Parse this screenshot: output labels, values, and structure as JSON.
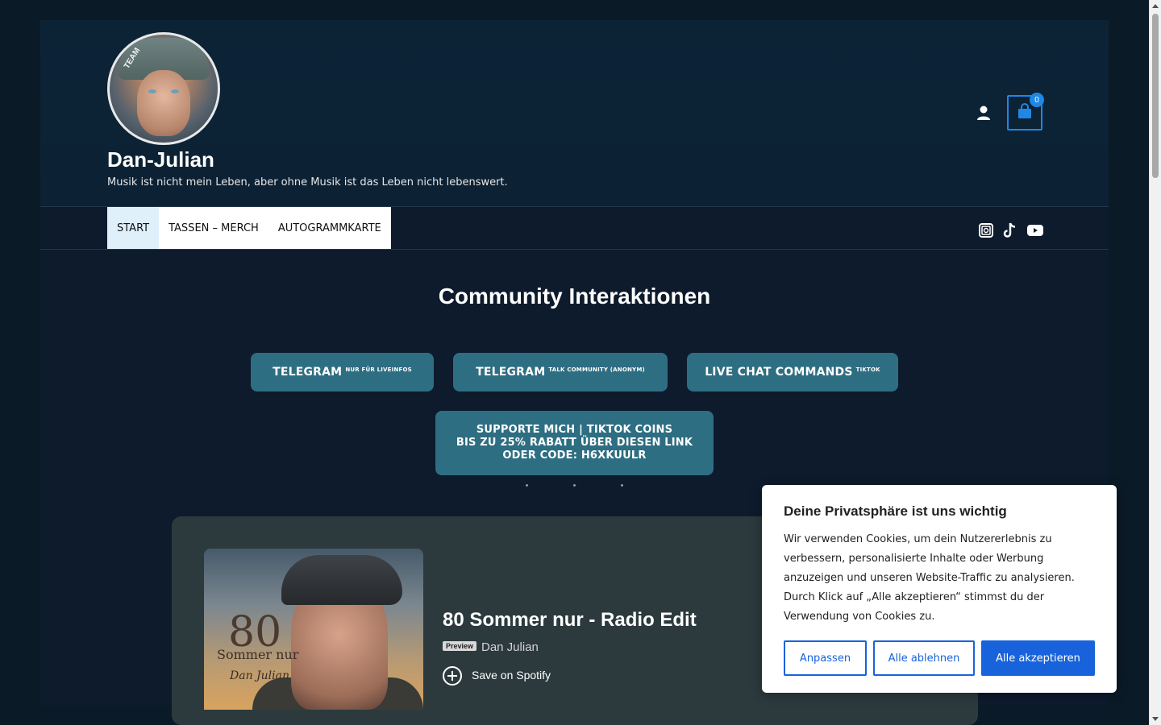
{
  "header": {
    "site_title": "Dan-Julian",
    "tagline": "Musik ist nicht mein Leben, aber ohne Musik ist das Leben nicht lebenswert.",
    "logo_text": "TEAM",
    "cart_count": "0",
    "icons": {
      "account": "user-icon",
      "cart": "shopping-bag-icon"
    }
  },
  "nav": {
    "items": [
      {
        "label": "START",
        "active": true
      },
      {
        "label": "TASSEN – MERCH",
        "active": false
      },
      {
        "label": "AUTOGRAMMKARTE",
        "active": false
      }
    ],
    "social": [
      "instagram-icon",
      "tiktok-icon",
      "youtube-icon"
    ]
  },
  "main": {
    "heading": "Community Interaktionen",
    "buttons": [
      {
        "label": "TELEGRAM",
        "sup": "NUR FÜR LIVEINFOS"
      },
      {
        "label": "TELEGRAM",
        "sup": "TALK COMMUNITY (ANONYM)"
      },
      {
        "label": "LIVE CHAT COMMANDS",
        "sup": "TIKTOK"
      }
    ],
    "support_button": {
      "line1": "SUPPORTE MICH | TIKTOK COINS",
      "line2": "BIS ZU 25% RABATT ÜBER DIESEN LINK",
      "line3": "ODER CODE: H6XKUULR"
    }
  },
  "player": {
    "track_title": "80 Sommer nur - Radio Edit",
    "badge": "Preview",
    "artist": "Dan Julian",
    "save_label": "Save on Spotify",
    "cover": {
      "number": "80",
      "title": "Sommer nur",
      "signature": "Dan Julian"
    }
  },
  "cookie": {
    "title": "Deine Privatsphäre ist uns wichtig",
    "text": "Wir verwenden Cookies, um dein Nutzererlebnis zu verbessern, personalisierte Inhalte oder Werbung anzuzeigen und unseren Website-Traffic zu analysieren. Durch Klick auf „Alle akzeptieren“ stimmst du der Verwendung von Cookies zu.",
    "btn_customize": "Anpassen",
    "btn_reject": "Alle ablehnen",
    "btn_accept": "Alle akzeptieren"
  },
  "colors": {
    "page_bg": "#0b1a27",
    "accent": "#1e88e5",
    "button_teal": "#2e6e82",
    "cookie_blue": "#1863dc"
  }
}
